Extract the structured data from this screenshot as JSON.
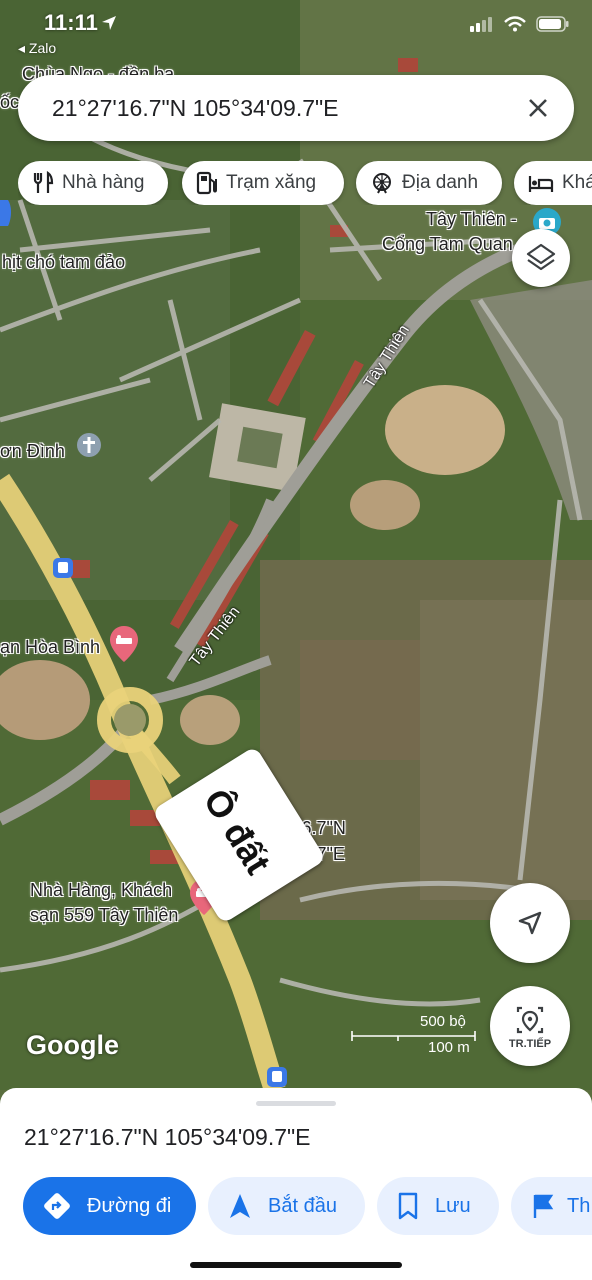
{
  "status_bar": {
    "time": "11:11",
    "back_app": "◂ Zalo"
  },
  "search": {
    "query": "21°27'16.7\"N 105°34'09.7\"E"
  },
  "chips": [
    {
      "label": "Nhà hàng",
      "icon": "fork-knife-icon"
    },
    {
      "label": "Trạm xăng",
      "icon": "gas-station-icon"
    },
    {
      "label": "Địa danh",
      "icon": "ferris-wheel-icon"
    },
    {
      "label": "Khá",
      "icon": "bed-icon"
    }
  ],
  "map_labels": {
    "tay_thien_cong": "Tây Thiên -",
    "tay_thien_cong_2": "Cổng Tam Quan",
    "thit_cho": "hịt chó tam đảo",
    "son_dinh": "ơn Đình",
    "hoa_binh": "ạn Hòa Bình",
    "nha_hang_559": "Nhà Hàng, Khách",
    "nha_hang_559_2": "sạn 559 Tây Thiên",
    "pin_coord_1": "7'16.7\"N",
    "pin_coord_2": "4'09.7\"E",
    "street_tay_thien_1": "Tây Thiên",
    "street_tay_thien_2": "Tây Thiên",
    "chua": "Chùa Ngọ - đền ba",
    "oc": "ốc"
  },
  "overlay": {
    "sticker_text": "Ô đất"
  },
  "branding": {
    "google": "Google"
  },
  "scale": {
    "imperial": "500 bộ",
    "metric": "100 m"
  },
  "buttons": {
    "tr_tiep": "TR.TIẾP"
  },
  "bottom_sheet": {
    "coords": "21°27'16.7\"N 105°34'09.7\"E",
    "actions": [
      {
        "label": "Đường đi",
        "icon": "directions-icon"
      },
      {
        "label": "Bắt đầu",
        "icon": "navigation-arrow-icon"
      },
      {
        "label": "Lưu",
        "icon": "bookmark-icon"
      },
      {
        "label": "Th",
        "icon": "flag-icon"
      }
    ]
  },
  "colors": {
    "accent": "#1a73e8",
    "accent_light": "#e8f0fe",
    "road_major": "#e9d27a",
    "map_green": "#4f6b35"
  }
}
